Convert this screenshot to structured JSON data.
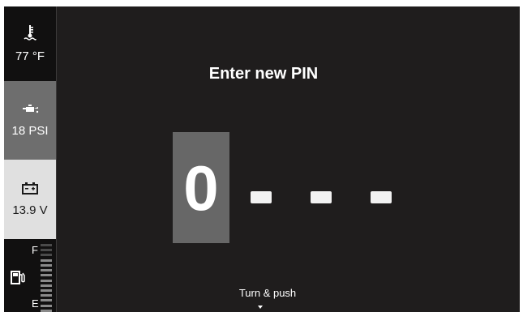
{
  "sidebar": {
    "temperature": {
      "icon": "coolant-temperature-icon",
      "value": "77 °F"
    },
    "oil_pressure": {
      "icon": "oil-pressure-icon",
      "value": "18 PSI"
    },
    "battery": {
      "icon": "battery-icon",
      "value": "13.9 V"
    },
    "fuel": {
      "icon": "fuel-pump-icon",
      "full_label": "F",
      "empty_label": "E",
      "level": 0.82
    }
  },
  "pin_entry": {
    "title": "Enter new PIN",
    "digits": [
      "0",
      "-",
      "-",
      "-"
    ],
    "active_index": 0,
    "hint": "Turn & push"
  },
  "colors": {
    "background": "#1f1d1d",
    "selected_digit_bg": "#676767",
    "selected_tile": "#6e6e6e",
    "light_tile": "#e0e0e0",
    "marker": "#d6322a"
  }
}
